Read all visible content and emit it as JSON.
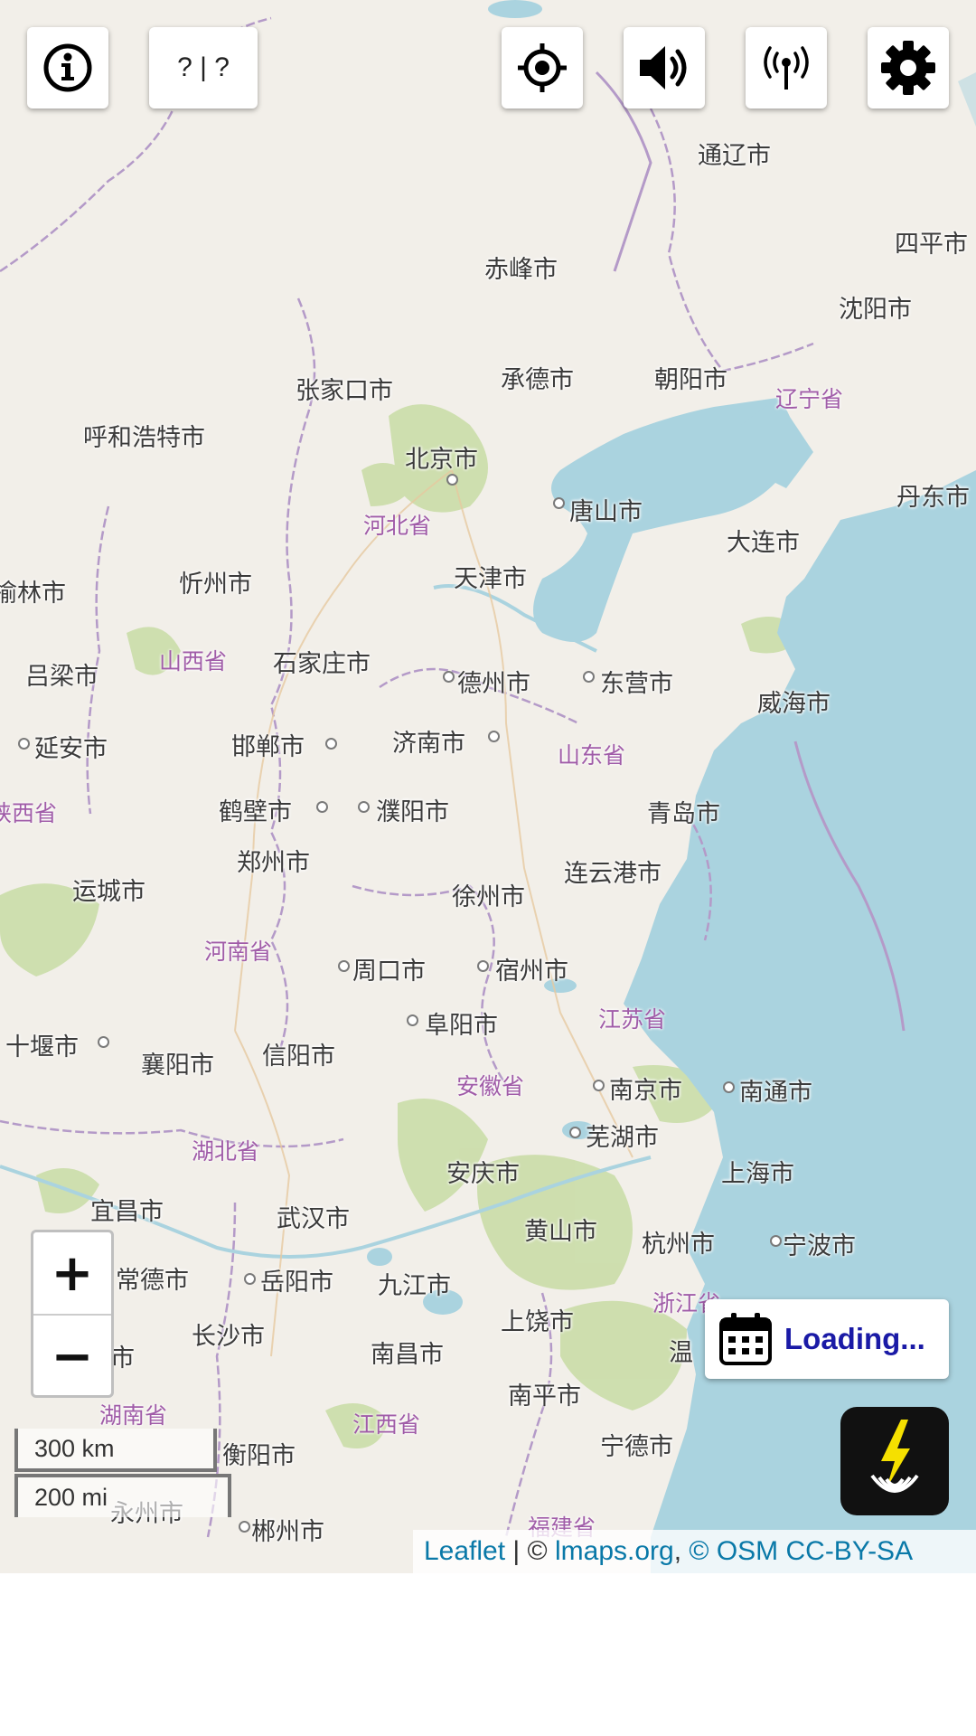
{
  "toolbar": {
    "info_icon": "info-icon",
    "coords_text": "? | ?",
    "locate_icon": "crosshair-icon",
    "sound_icon": "speaker-icon",
    "signal_icon": "antenna-icon",
    "settings_icon": "gear-icon"
  },
  "map": {
    "cities": [
      {
        "name": "通辽市"
      },
      {
        "name": "四平市"
      },
      {
        "name": "赤峰市"
      },
      {
        "name": "沈阳市"
      },
      {
        "name": "张家口市"
      },
      {
        "name": "承德市"
      },
      {
        "name": "朝阳市"
      },
      {
        "name": "呼和浩特市"
      },
      {
        "name": "北京市"
      },
      {
        "name": "唐山市"
      },
      {
        "name": "丹东市"
      },
      {
        "name": "大连市"
      },
      {
        "name": "天津市"
      },
      {
        "name": "榆林市"
      },
      {
        "name": "忻州市"
      },
      {
        "name": "吕梁市"
      },
      {
        "name": "石家庄市"
      },
      {
        "name": "德州市"
      },
      {
        "name": "东营市"
      },
      {
        "name": "威海市"
      },
      {
        "name": "延安市"
      },
      {
        "name": "邯郸市"
      },
      {
        "name": "济南市"
      },
      {
        "name": "鹤壁市"
      },
      {
        "name": "濮阳市"
      },
      {
        "name": "青岛市"
      },
      {
        "name": "郑州市"
      },
      {
        "name": "连云港市"
      },
      {
        "name": "运城市"
      },
      {
        "name": "徐州市"
      },
      {
        "name": "周口市"
      },
      {
        "name": "宿州市"
      },
      {
        "name": "阜阳市"
      },
      {
        "name": "十堰市"
      },
      {
        "name": "襄阳市"
      },
      {
        "name": "信阳市"
      },
      {
        "name": "南京市"
      },
      {
        "name": "南通市"
      },
      {
        "name": "芜湖市"
      },
      {
        "name": "安庆市"
      },
      {
        "name": "上海市"
      },
      {
        "name": "宜昌市"
      },
      {
        "name": "武汉市"
      },
      {
        "name": "黄山市"
      },
      {
        "name": "杭州市"
      },
      {
        "name": "宁波市"
      },
      {
        "name": "常德市"
      },
      {
        "name": "岳阳市"
      },
      {
        "name": "九江市"
      },
      {
        "name": "长沙市"
      },
      {
        "name": "上饶市"
      },
      {
        "name": "南昌市"
      },
      {
        "name": "南平市"
      },
      {
        "name": "宁德市"
      },
      {
        "name": "衡阳市"
      },
      {
        "name": "郴州市"
      },
      {
        "name": "永州市"
      },
      {
        "name": "温"
      },
      {
        "name": "市"
      }
    ],
    "provinces": [
      {
        "name": "辽宁省"
      },
      {
        "name": "河北省"
      },
      {
        "name": "山西省"
      },
      {
        "name": "山东省"
      },
      {
        "name": "陕西省"
      },
      {
        "name": "河南省"
      },
      {
        "name": "江苏省"
      },
      {
        "name": "安徽省"
      },
      {
        "name": "湖北省"
      },
      {
        "name": "浙江省"
      },
      {
        "name": "湖南省"
      },
      {
        "name": "江西省"
      },
      {
        "name": "福建省"
      }
    ],
    "colors": {
      "land": "#f2efe9",
      "sea": "#aad3df",
      "park": "#c8dca4",
      "boundary": "#b49ac8",
      "road": "#e8d9b0"
    }
  },
  "zoom": {
    "in_label": "+",
    "out_label": "−"
  },
  "scale": {
    "km": "300 km",
    "mi": "200 mi"
  },
  "loading": {
    "icon": "calendar-icon",
    "label": "Loading..."
  },
  "logo": {
    "icon": "lightning-radar-icon"
  },
  "attribution": {
    "leaflet": "Leaflet",
    "sep1": " | © ",
    "lmaps": "lmaps.org",
    "sep2": ", ",
    "osm": "© OSM CC-BY-SA"
  }
}
